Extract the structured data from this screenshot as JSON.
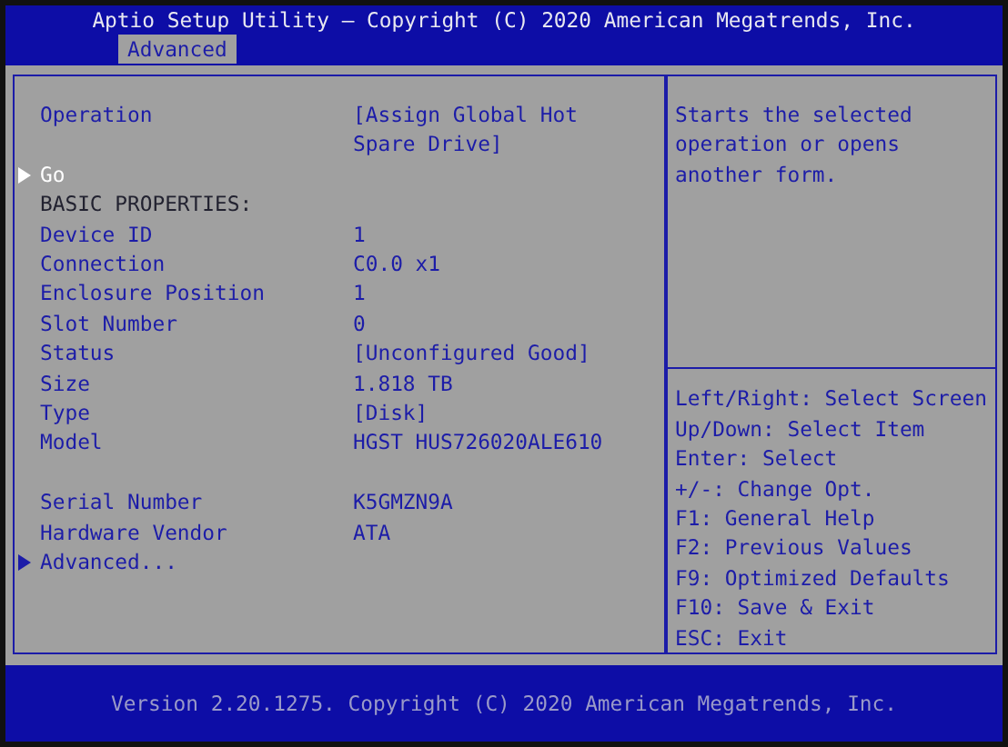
{
  "title": "Aptio Setup Utility – Copyright (C) 2020 American Megatrends, Inc.",
  "tabs": [
    {
      "label": "Advanced",
      "selected": true
    }
  ],
  "items": [
    {
      "kind": "option",
      "label": "Operation",
      "value": "[Assign Global Hot Spare Drive]",
      "selected": false
    },
    {
      "kind": "submenu",
      "label": "Go",
      "selected": true
    },
    {
      "kind": "heading",
      "label": "BASIC PROPERTIES:"
    },
    {
      "kind": "info",
      "label": "Device ID",
      "value": "1"
    },
    {
      "kind": "info",
      "label": "Connection",
      "value": "C0.0 x1"
    },
    {
      "kind": "info",
      "label": "Enclosure Position",
      "value": "1"
    },
    {
      "kind": "info",
      "label": "Slot Number",
      "value": "0"
    },
    {
      "kind": "info",
      "label": "Status",
      "value": "[Unconfigured Good]"
    },
    {
      "kind": "info",
      "label": "Size",
      "value": "1.818 TB"
    },
    {
      "kind": "info",
      "label": "Type",
      "value": "[Disk]"
    },
    {
      "kind": "info",
      "label": "Model",
      "value": "HGST HUS726020ALE610"
    },
    {
      "kind": "spacer"
    },
    {
      "kind": "info",
      "label": "Serial Number",
      "value": "K5GMZN9A"
    },
    {
      "kind": "info",
      "label": "Hardware Vendor",
      "value": "ATA"
    },
    {
      "kind": "submenu",
      "label": "Advanced...",
      "selected": false
    }
  ],
  "help_text": "Starts the selected operation or opens another form.",
  "key_hints": [
    "Left/Right: Select Screen",
    "Up/Down: Select Item",
    "Enter: Select",
    "+/-: Change Opt.",
    "F1: General Help",
    "F2: Previous Values",
    "F9: Optimized Defaults",
    "F10: Save & Exit",
    "ESC: Exit"
  ],
  "footer": "Version 2.20.1275. Copyright (C) 2020 American Megatrends, Inc."
}
